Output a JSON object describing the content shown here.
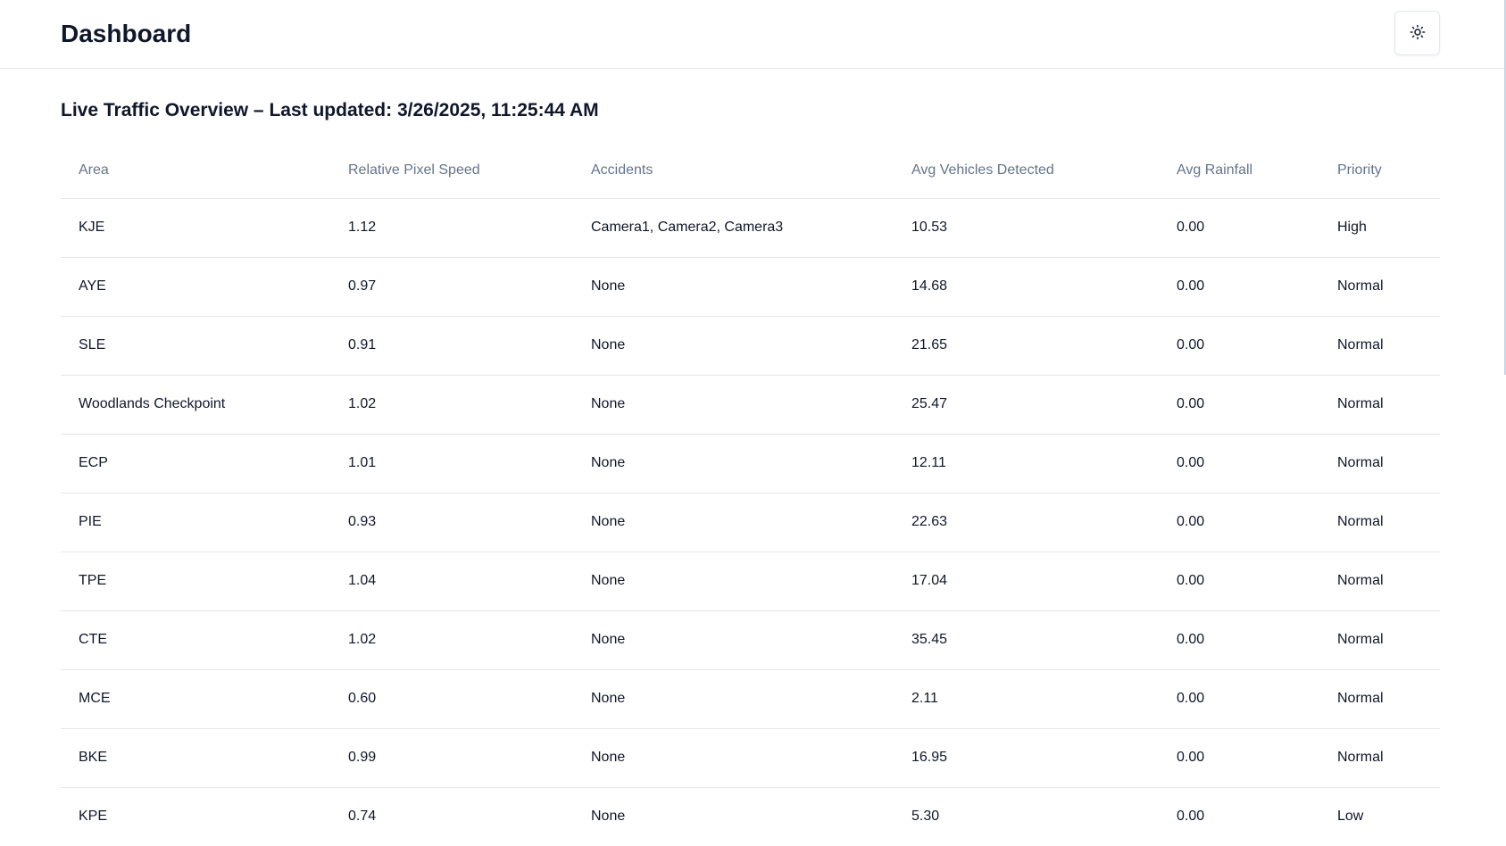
{
  "header": {
    "title": "Dashboard",
    "theme_toggle_icon": "sun-icon"
  },
  "section": {
    "title": "Live Traffic Overview – Last updated: 3/26/2025, 11:25:44 AM"
  },
  "table": {
    "columns": [
      "Area",
      "Relative Pixel Speed",
      "Accidents",
      "Avg Vehicles Detected",
      "Avg Rainfall",
      "Priority"
    ],
    "rows": [
      [
        "KJE",
        "1.12",
        "Camera1, Camera2, Camera3",
        "10.53",
        "0.00",
        "High"
      ],
      [
        "AYE",
        "0.97",
        "None",
        "14.68",
        "0.00",
        "Normal"
      ],
      [
        "SLE",
        "0.91",
        "None",
        "21.65",
        "0.00",
        "Normal"
      ],
      [
        "Woodlands Checkpoint",
        "1.02",
        "None",
        "25.47",
        "0.00",
        "Normal"
      ],
      [
        "ECP",
        "1.01",
        "None",
        "12.11",
        "0.00",
        "Normal"
      ],
      [
        "PIE",
        "0.93",
        "None",
        "22.63",
        "0.00",
        "Normal"
      ],
      [
        "TPE",
        "1.04",
        "None",
        "17.04",
        "0.00",
        "Normal"
      ],
      [
        "CTE",
        "1.02",
        "None",
        "35.45",
        "0.00",
        "Normal"
      ],
      [
        "MCE",
        "0.60",
        "None",
        "2.11",
        "0.00",
        "Normal"
      ],
      [
        "BKE",
        "0.99",
        "None",
        "16.95",
        "0.00",
        "Normal"
      ],
      [
        "KPE",
        "0.74",
        "None",
        "5.30",
        "0.00",
        "Low"
      ]
    ]
  }
}
